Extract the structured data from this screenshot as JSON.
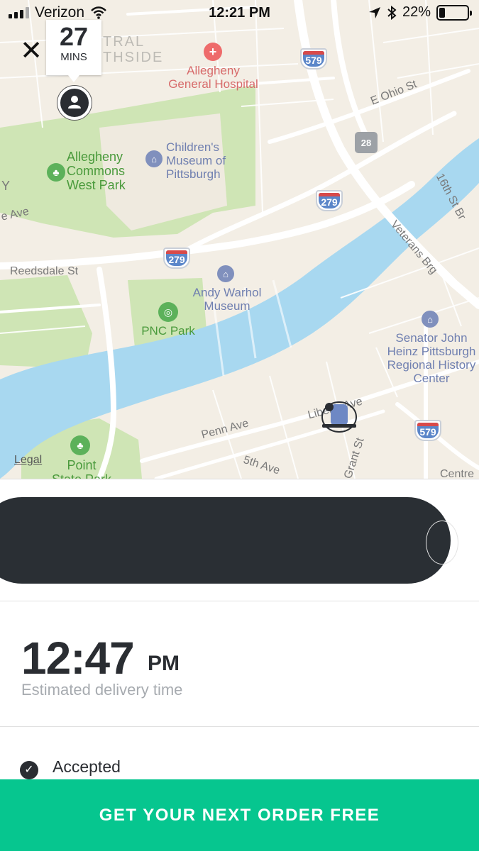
{
  "status_bar": {
    "carrier": "Verizon",
    "time": "12:21 PM",
    "battery_text": "22%",
    "battery_level": 0.22
  },
  "map": {
    "eta": {
      "value": "27",
      "unit": "MINS"
    },
    "district_label": "TRAL\nTHSIDE",
    "labels": {
      "hospital": "Allegheny\nGeneral Hospital",
      "commons": "Allegheny\nCommons\nWest Park",
      "childrens_museum": "Children's\nMuseum of\nPittsburgh",
      "warhol": "Andy Warhol\nMuseum",
      "pnc_park": "PNC Park",
      "heinz": "Senator John\nHeinz Pittsburgh\nRegional History\nCenter",
      "point_state": "Point\nState Park",
      "e_ohio": "E Ohio St",
      "veterans": "Veterans Brg",
      "sixteenth": "16th St Br",
      "reedsdale": "Reedsdale St",
      "penn": "Penn Ave",
      "liberty": "Liberty Ave",
      "fifth": "5th Ave",
      "grant": "Grant St",
      "ave_left": "e Ave",
      "centre": "Centre",
      "y_left": "Y"
    },
    "shields": {
      "i579_top": "579",
      "i279_right": "279",
      "i279_left": "279",
      "i579_bottom": "579",
      "route28": "28"
    },
    "legal": "Legal"
  },
  "delivery": {
    "time": "12:47",
    "ampm": "PM",
    "caption": "Estimated delivery time"
  },
  "steps": [
    {
      "label": "Accepted"
    }
  ],
  "cta": {
    "label": "GET YOUR NEXT ORDER FREE"
  }
}
